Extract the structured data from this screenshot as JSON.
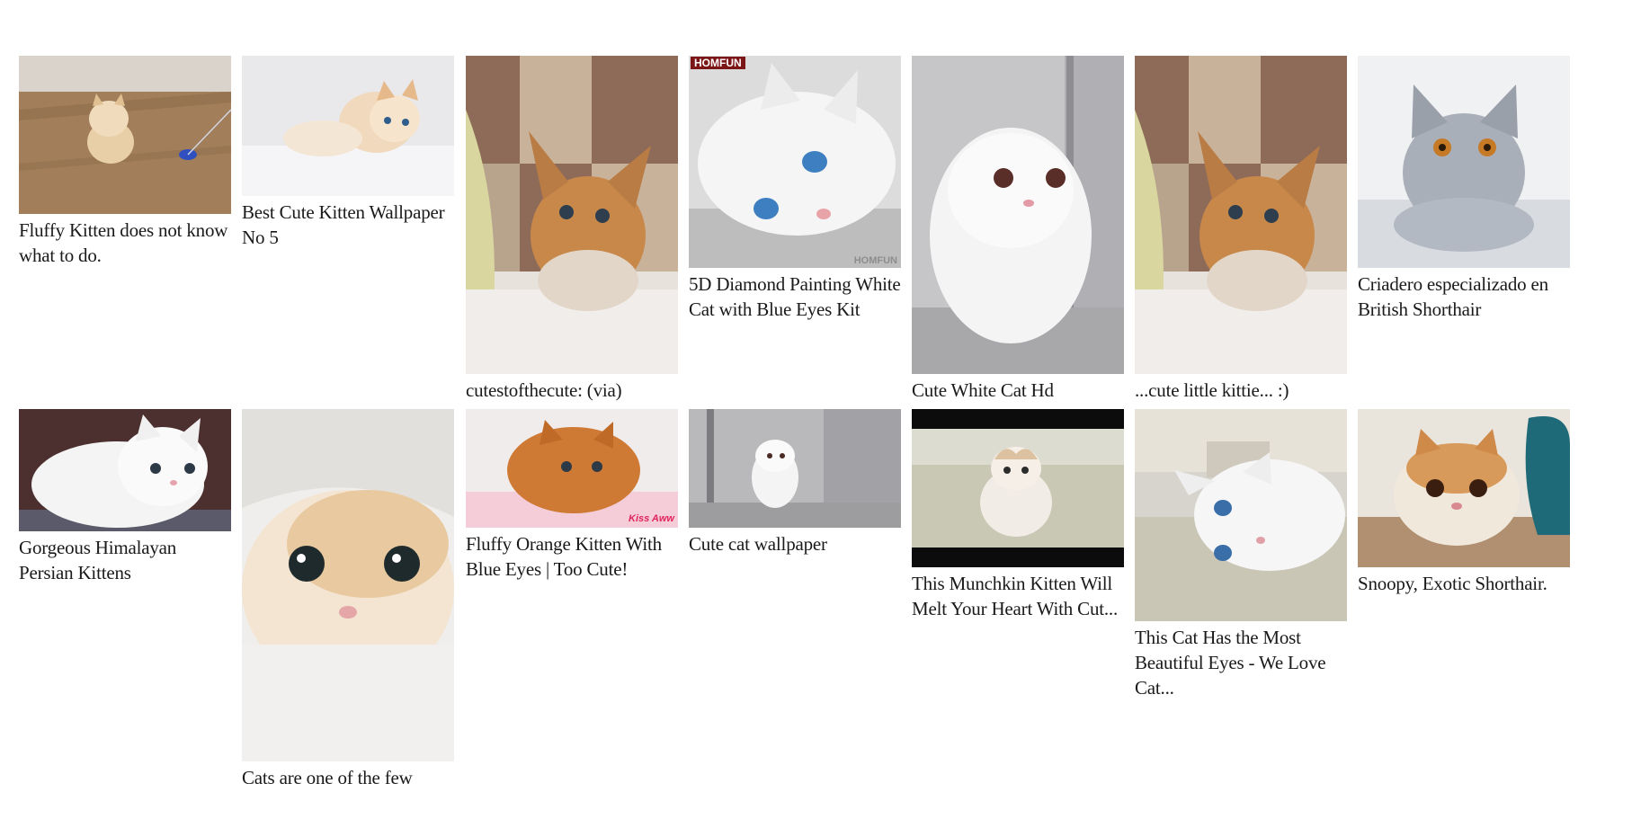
{
  "results": [
    {
      "caption": "Fluffy Kitten does not know what to do.",
      "image": "kitten-photo-icon"
    },
    {
      "caption": "Best Cute Kitten Wallpaper No 5",
      "image": "kitten-photo-icon"
    },
    {
      "caption": "cutestofthecute: (via)",
      "image": "kitten-photo-icon"
    },
    {
      "caption": "5D Diamond Painting White Cat with Blue Eyes Kit",
      "image": "white-cat-photo-icon",
      "badge": "HOMFUN",
      "watermark": "HOMFUN"
    },
    {
      "caption": "Cute White Cat Hd",
      "image": "white-cat-photo-icon"
    },
    {
      "caption": "...cute little kittie... :)",
      "image": "kitten-photo-icon"
    },
    {
      "caption": "Criadero especializado en British Shorthair",
      "image": "grey-cat-photo-icon"
    },
    {
      "caption": "Gorgeous Himalayan Persian Kittens",
      "image": "white-kitten-photo-icon"
    },
    {
      "caption": "Cats are one of the few",
      "image": "kitten-face-photo-icon"
    },
    {
      "caption": "Fluffy Orange Kitten With Blue Eyes | Too Cute!",
      "image": "orange-kitten-photo-icon",
      "tag": "Kiss Aww"
    },
    {
      "caption": "Cute cat wallpaper",
      "image": "white-cat-photo-icon"
    },
    {
      "caption": "This Munchkin Kitten Will Melt Your Heart With Cut...",
      "image": "munchkin-kitten-photo-icon"
    },
    {
      "caption": "This Cat Has the Most Beautiful Eyes - We Love Cat...",
      "image": "white-cat-photo-icon"
    },
    {
      "caption": "Snoopy, Exotic Shorthair.",
      "image": "exotic-cat-photo-icon"
    }
  ],
  "colors": {
    "background": "#ffffff",
    "caption": "#1a1a1a"
  }
}
